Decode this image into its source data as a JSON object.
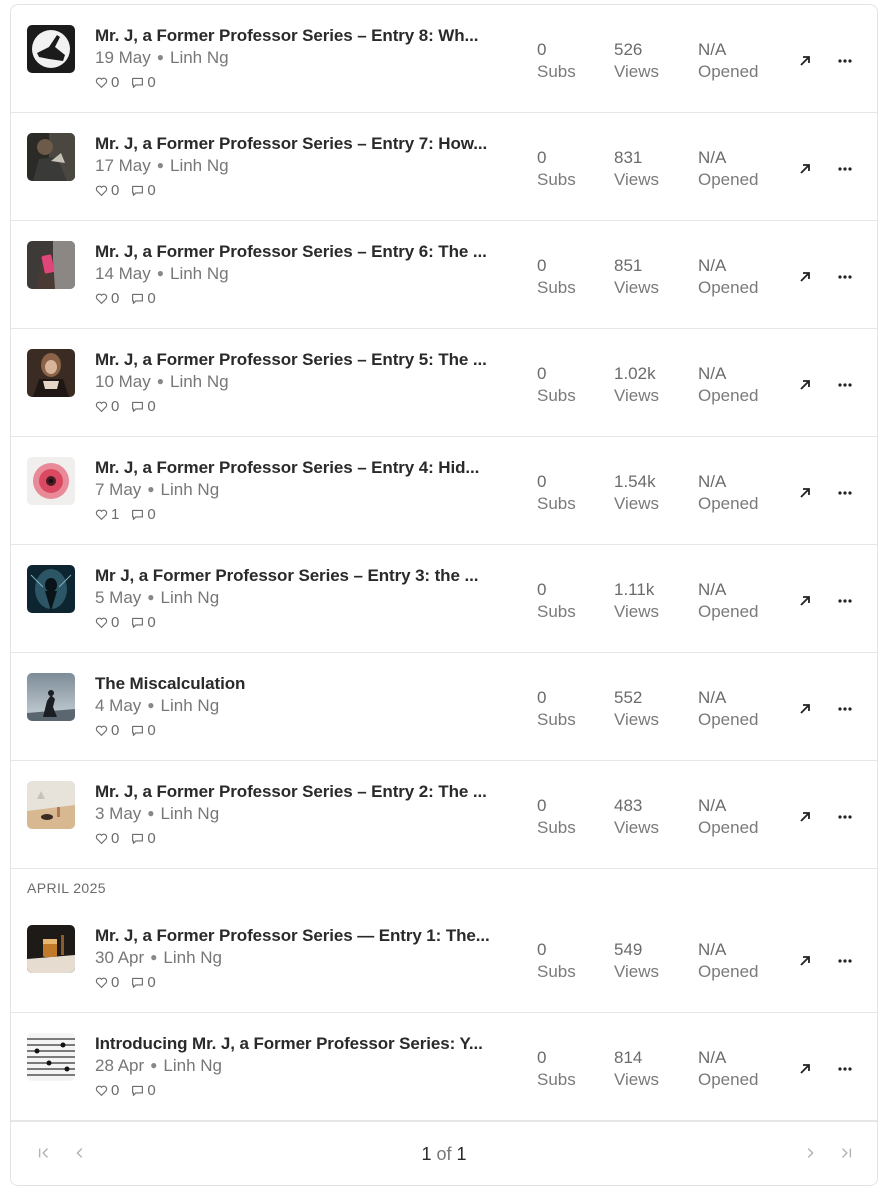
{
  "posts": [
    {
      "title": "Mr. J, a Former Professor Series – Entry 8: Wh...",
      "date": "19 May",
      "author": "Linh Ng",
      "likes": "0",
      "comments": "0",
      "subs": "0",
      "subs_label": "Subs",
      "views": "526",
      "views_label": "Views",
      "opened": "N/A",
      "opened_label": "Opened",
      "thumb": "hand-silhouette-thumbnail"
    },
    {
      "title": "Mr. J, a Former Professor Series – Entry 7: How...",
      "date": "17 May",
      "author": "Linh Ng",
      "likes": "0",
      "comments": "0",
      "subs": "0",
      "subs_label": "Subs",
      "views": "831",
      "views_label": "Views",
      "opened": "N/A",
      "opened_label": "Opened",
      "thumb": "man-in-suit-thumbnail"
    },
    {
      "title": "Mr. J, a Former Professor Series – Entry 6: The ...",
      "date": "14 May",
      "author": "Linh Ng",
      "likes": "0",
      "comments": "0",
      "subs": "0",
      "subs_label": "Subs",
      "views": "851",
      "views_label": "Views",
      "opened": "N/A",
      "opened_label": "Opened",
      "thumb": "phone-in-hand-thumbnail"
    },
    {
      "title": "Mr. J, a Former Professor Series – Entry 5: The ...",
      "date": "10 May",
      "author": "Linh Ng",
      "likes": "0",
      "comments": "0",
      "subs": "0",
      "subs_label": "Subs",
      "views": "1.02k",
      "views_label": "Views",
      "opened": "N/A",
      "opened_label": "Opened",
      "thumb": "woman-portrait-thumbnail"
    },
    {
      "title": "Mr. J, a Former Professor Series – Entry 4: Hid...",
      "date": "7 May",
      "author": "Linh Ng",
      "likes": "1",
      "comments": "0",
      "subs": "0",
      "subs_label": "Subs",
      "views": "1.54k",
      "views_label": "Views",
      "opened": "N/A",
      "opened_label": "Opened",
      "thumb": "red-flower-thumbnail"
    },
    {
      "title": "Mr J, a Former Professor Series – Entry 3: the ...",
      "date": "5 May",
      "author": "Linh Ng",
      "likes": "0",
      "comments": "0",
      "subs": "0",
      "subs_label": "Subs",
      "views": "1.11k",
      "views_label": "Views",
      "opened": "N/A",
      "opened_label": "Opened",
      "thumb": "dark-figure-thumbnail"
    },
    {
      "title": "The Miscalculation",
      "date": "4 May",
      "author": "Linh Ng",
      "likes": "0",
      "comments": "0",
      "subs": "0",
      "subs_label": "Subs",
      "views": "552",
      "views_label": "Views",
      "opened": "N/A",
      "opened_label": "Opened",
      "thumb": "storm-figure-thumbnail"
    },
    {
      "title": "Mr. J, a Former Professor Series – Entry 2: The ...",
      "date": "3 May",
      "author": "Linh Ng",
      "likes": "0",
      "comments": "0",
      "subs": "0",
      "subs_label": "Subs",
      "views": "483",
      "views_label": "Views",
      "opened": "N/A",
      "opened_label": "Opened",
      "thumb": "desk-still-life-thumbnail"
    },
    {
      "title": "Mr. J, a Former Professor Series — Entry 1: The...",
      "date": "30 Apr",
      "author": "Linh Ng",
      "likes": "0",
      "comments": "0",
      "subs": "0",
      "subs_label": "Subs",
      "views": "549",
      "views_label": "Views",
      "opened": "N/A",
      "opened_label": "Opened",
      "thumb": "whiskey-glass-thumbnail"
    },
    {
      "title": "Introducing Mr. J, a Former Professor Series: Y...",
      "date": "28 Apr",
      "author": "Linh Ng",
      "likes": "0",
      "comments": "0",
      "subs": "0",
      "subs_label": "Subs",
      "views": "814",
      "views_label": "Views",
      "opened": "N/A",
      "opened_label": "Opened",
      "thumb": "music-staff-thumbnail"
    }
  ],
  "section_header": "APRIL 2025",
  "pagination": {
    "current": "1",
    "of_label": "of",
    "total": "1"
  },
  "icons": {
    "open_post": "arrow-up-right-icon",
    "more_actions": "ellipsis-icon",
    "likes": "heart-icon",
    "comments": "comment-icon",
    "first_page": "first-page-icon",
    "prev_page": "chevron-left-icon",
    "next_page": "chevron-right-icon",
    "last_page": "last-page-icon"
  }
}
